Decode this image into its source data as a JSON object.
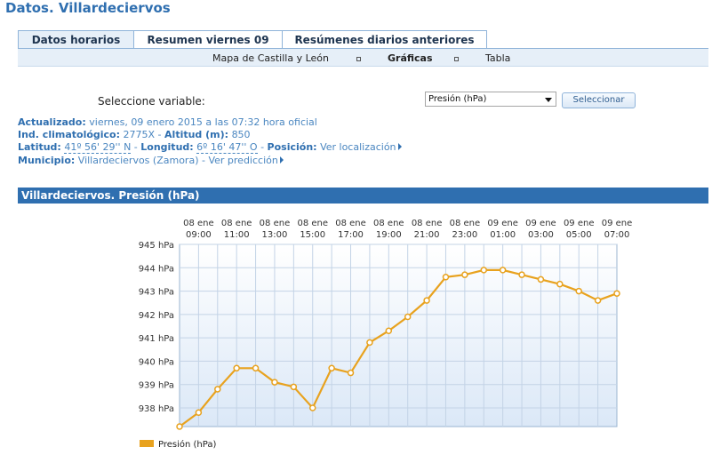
{
  "page": {
    "title": "Datos. Villardeciervos"
  },
  "tabs": [
    {
      "label": "Datos horarios",
      "active": true
    },
    {
      "label": "Resumen viernes 09",
      "active": false
    },
    {
      "label": "Resúmenes diarios anteriores",
      "active": false
    }
  ],
  "subnav": {
    "items": [
      "Mapa de Castilla y León",
      "Gráficas",
      "Tabla"
    ],
    "current": "Gráficas"
  },
  "selector": {
    "label": "Seleccione variable:",
    "value": "Presión (hPa)",
    "button": "Seleccionar"
  },
  "info": {
    "updated_label": "Actualizado:",
    "updated_value": "viernes, 09 enero 2015 a las 07:32 hora oficial",
    "ind_label": "Ind. climatológico:",
    "ind_value": "2775X",
    "alt_label": "Altitud (m):",
    "alt_value": "850",
    "lat_label": "Latitud:",
    "lat_value": "41º 56' 29'' N",
    "lon_label": "Longitud:",
    "lon_value": "6º 16' 47'' O",
    "pos_label": "Posición:",
    "pos_link": "Ver localización",
    "mun_label": "Municipio:",
    "mun_value": "Villardeciervos (Zamora)",
    "pred_link": "Ver predicción"
  },
  "section": {
    "title": "Villardeciervos. Presión (hPa)"
  },
  "chart_data": {
    "type": "line",
    "ylim": [
      937.2,
      945
    ],
    "yticks": [
      938,
      939,
      940,
      941,
      942,
      943,
      944,
      945
    ],
    "y_unit": "hPa",
    "grid": true,
    "legend_placement": "bottom-left",
    "x_top_labels": [
      [
        "08 ene",
        "09:00"
      ],
      [
        "08 ene",
        "11:00"
      ],
      [
        "08 ene",
        "13:00"
      ],
      [
        "08 ene",
        "15:00"
      ],
      [
        "08 ene",
        "17:00"
      ],
      [
        "08 ene",
        "19:00"
      ],
      [
        "08 ene",
        "21:00"
      ],
      [
        "08 ene",
        "23:00"
      ],
      [
        "09 ene",
        "01:00"
      ],
      [
        "09 ene",
        "03:00"
      ],
      [
        "09 ene",
        "05:00"
      ],
      [
        "09 ene",
        "07:00"
      ]
    ],
    "series": [
      {
        "name": "Presión (hPa)",
        "color": "#e8a21e",
        "x": [
          "08 ene 08:00",
          "08 ene 09:00",
          "08 ene 10:00",
          "08 ene 11:00",
          "08 ene 12:00",
          "08 ene 13:00",
          "08 ene 14:00",
          "08 ene 15:00",
          "08 ene 16:00",
          "08 ene 17:00",
          "08 ene 18:00",
          "08 ene 19:00",
          "08 ene 20:00",
          "08 ene 21:00",
          "08 ene 22:00",
          "08 ene 23:00",
          "09 ene 00:00",
          "09 ene 01:00",
          "09 ene 02:00",
          "09 ene 03:00",
          "09 ene 04:00",
          "09 ene 05:00",
          "09 ene 06:00",
          "09 ene 07:00"
        ],
        "values": [
          937.2,
          937.8,
          938.8,
          939.7,
          939.7,
          939.1,
          938.9,
          938.0,
          939.7,
          939.5,
          940.8,
          941.3,
          941.9,
          942.6,
          943.6,
          943.7,
          943.9,
          943.9,
          943.7,
          943.5,
          943.3,
          943.0,
          942.6,
          942.9
        ]
      }
    ]
  }
}
